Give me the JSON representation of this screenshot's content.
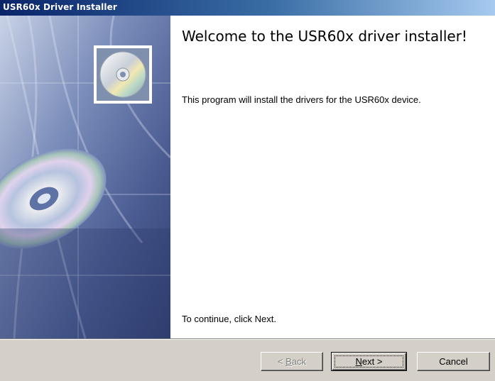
{
  "window": {
    "title": "USR60x Driver Installer"
  },
  "welcome": {
    "heading": "Welcome to the USR60x driver installer!",
    "description": "This program will install the drivers for the USR60x device.",
    "continue_hint": "To continue, click Next."
  },
  "buttons": {
    "back": {
      "prefix": "< ",
      "mnemonic": "B",
      "rest": "ack",
      "enabled": false
    },
    "next": {
      "mnemonic": "N",
      "rest": "ext >",
      "enabled": true,
      "default": true
    },
    "cancel": {
      "label": "Cancel",
      "enabled": true
    }
  },
  "side_image": {
    "icon": "cd-disc-icon"
  }
}
